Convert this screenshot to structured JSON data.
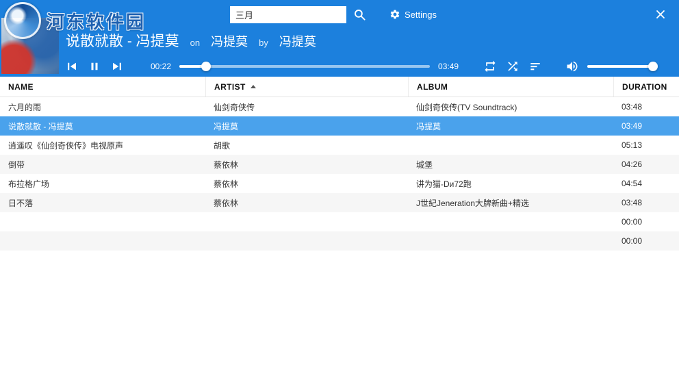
{
  "watermark": {
    "site_name": "河东软件园"
  },
  "titlebar": {
    "search_value": "三月",
    "settings_label": "Settings"
  },
  "now_playing": {
    "title": "说散就散 - 冯提莫",
    "on_label": "on",
    "album": "冯提莫",
    "by_label": "by",
    "artist": "冯提莫",
    "elapsed": "00:22",
    "total": "03:49",
    "progress_pct": 10.7,
    "volume_pct": 100
  },
  "icons": {
    "search": "magnifier",
    "settings": "gear",
    "close": "x-cross",
    "previous": "skip-previous",
    "pause": "pause-bars",
    "next": "skip-next",
    "repeat": "loop-arrows",
    "shuffle": "crossed-arrows",
    "filter": "sort-lines",
    "volume": "speaker-waves",
    "sort_indicator": "caret-up"
  },
  "colors": {
    "header_blue": "#1c80dd",
    "selected_row_blue": "#4aa2ec"
  },
  "table": {
    "headers": {
      "name": "NAME",
      "artist": "ARTIST",
      "album": "ALBUM",
      "duration": "DURATION"
    },
    "sorted_by": "ARTIST",
    "rows": [
      {
        "name": "六月的雨",
        "artist": "仙剑奇侠传",
        "album": "仙剑奇侠传(TV Soundtrack)",
        "duration": "03:48",
        "selected": false
      },
      {
        "name": "说散就散 - 冯提莫",
        "artist": "冯提莫",
        "album": "冯提莫",
        "duration": "03:49",
        "selected": true
      },
      {
        "name": "逍遥叹《仙剑奇侠传》电视原声",
        "artist": "胡歌",
        "album": "",
        "duration": "05:13",
        "selected": false
      },
      {
        "name": "倒带",
        "artist": "蔡依林",
        "album": "城堡",
        "duration": "04:26",
        "selected": false
      },
      {
        "name": "布拉格广场",
        "artist": "蔡依林",
        "album": "讲为猫-Dи72跑",
        "duration": "04:54",
        "selected": false
      },
      {
        "name": "日不落",
        "artist": "蔡依林",
        "album": "J世紀Jeneration大牌新曲+精选",
        "duration": "03:48",
        "selected": false
      },
      {
        "name": "",
        "artist": "",
        "album": "",
        "duration": "00:00",
        "selected": false
      },
      {
        "name": "",
        "artist": "",
        "album": "",
        "duration": "00:00",
        "selected": false
      }
    ]
  }
}
